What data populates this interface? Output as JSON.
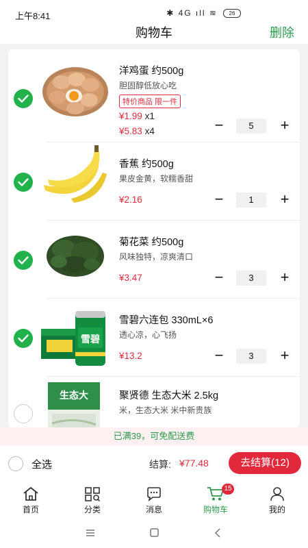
{
  "status_bar": {
    "time": "上午8:41",
    "indicators": "✱ 4G ıll ≋",
    "battery": "26"
  },
  "header": {
    "title": "购物车",
    "delete_label": "删除"
  },
  "items": [
    {
      "name": "洋鸡蛋 约500g",
      "desc": "胆固醇低放心吃",
      "tag": "特价商品 限一件",
      "price1": "¥1.99",
      "mul1": "x1",
      "price2": "¥5.83",
      "mul2": "x4",
      "qty": "5",
      "checked": true,
      "image": "eggs-basket"
    },
    {
      "name": "香蕉 约500g",
      "desc": "果皮金黄，软糯香甜",
      "price": "¥2.16",
      "qty": "1",
      "checked": true,
      "image": "bananas"
    },
    {
      "name": "菊花菜 约500g",
      "desc": "风味独特，凉爽清口",
      "price": "¥3.47",
      "qty": "3",
      "checked": true,
      "image": "chrysanthemum-greens"
    },
    {
      "name": "雪碧六连包  330mL×6",
      "desc": "透心凉，心飞扬",
      "price": "¥13.2",
      "qty": "3",
      "checked": true,
      "image": "sprite-pack",
      "brand_text": "雪碧"
    },
    {
      "name": "聚贤德 生态大米  2.5kg",
      "desc": "米，生态大米  米中新贵族",
      "checked": false,
      "image": "rice-bag",
      "brand_text": "生态大"
    }
  ],
  "notice": "已满39，可免配送费",
  "footer": {
    "select_all": "全选",
    "total_label": "结算:",
    "total_value": "¥77.48",
    "checkout": "去结算(12)"
  },
  "tabs": [
    {
      "label": "首页",
      "icon": "home-icon"
    },
    {
      "label": "分类",
      "icon": "category-icon"
    },
    {
      "label": "消息",
      "icon": "message-icon"
    },
    {
      "label": "购物车",
      "icon": "cart-icon",
      "badge": "15",
      "active": true
    },
    {
      "label": "我的",
      "icon": "profile-icon"
    }
  ],
  "colors": {
    "accent_green": "#2c9b4d",
    "check_green": "#21b24b",
    "price_red": "#e2293b"
  }
}
